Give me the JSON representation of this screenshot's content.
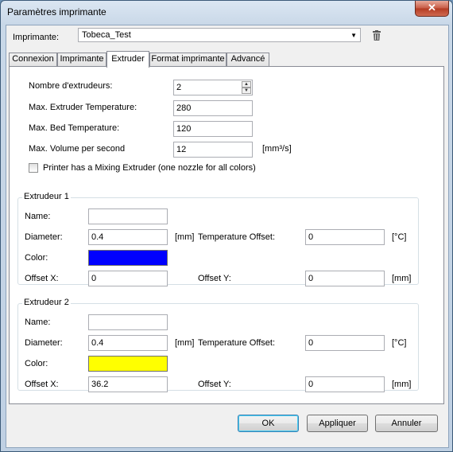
{
  "window": {
    "title": "Paramètres imprimante",
    "close_label": "✕"
  },
  "printer": {
    "label": "Imprimante:",
    "selected": "Tobeca_Test"
  },
  "tabs": [
    {
      "label": "Connexion"
    },
    {
      "label": "Imprimante"
    },
    {
      "label": "Extruder"
    },
    {
      "label": "Format imprimante"
    },
    {
      "label": "Advancé"
    }
  ],
  "general": {
    "num_extruders_label": "Nombre d'extrudeurs:",
    "num_extruders_value": "2",
    "max_extruder_temp_label": "Max. Extruder Temperature:",
    "max_extruder_temp_value": "280",
    "max_bed_temp_label": "Max. Bed Temperature:",
    "max_bed_temp_value": "120",
    "max_volume_label": "Max. Volume per second",
    "max_volume_value": "12",
    "max_volume_unit": "[mm³/s]",
    "mixing_label": "Printer has a Mixing Extruder (one nozzle for all colors)"
  },
  "extruder1": {
    "title": "Extrudeur 1",
    "name_label": "Name:",
    "name_value": "",
    "diameter_label": "Diameter:",
    "diameter_value": "0.4",
    "diameter_unit": "[mm]",
    "temp_offset_label": "Temperature Offset:",
    "temp_offset_value": "0",
    "temp_offset_unit": "[°C]",
    "color_label": "Color:",
    "color_value": "#0000ff",
    "offset_x_label": "Offset X:",
    "offset_x_value": "0",
    "offset_y_label": "Offset Y:",
    "offset_y_value": "0",
    "offset_unit": "[mm]"
  },
  "extruder2": {
    "title": "Extrudeur 2",
    "name_label": "Name:",
    "name_value": "",
    "diameter_label": "Diameter:",
    "diameter_value": "0.4",
    "diameter_unit": "[mm]",
    "temp_offset_label": "Temperature Offset:",
    "temp_offset_value": "0",
    "temp_offset_unit": "[°C]",
    "color_label": "Color:",
    "color_value": "#ffff00",
    "offset_x_label": "Offset X:",
    "offset_x_value": "36.2",
    "offset_y_label": "Offset Y:",
    "offset_y_value": "0",
    "offset_unit": "[mm]"
  },
  "buttons": {
    "ok": "OK",
    "apply": "Appliquer",
    "cancel": "Annuler"
  },
  "icons": {
    "trash": "trash-icon",
    "dropdown": "chevron-down-icon",
    "close": "close-icon"
  }
}
